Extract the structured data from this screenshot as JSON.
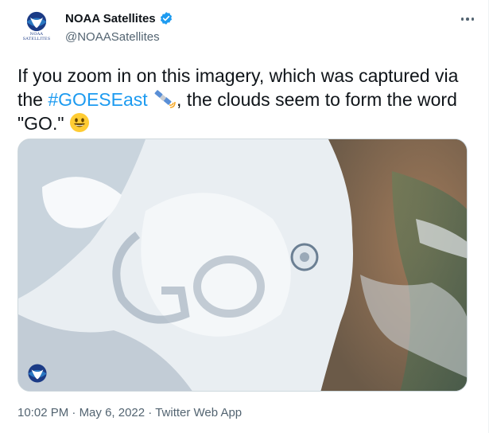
{
  "author": {
    "display_name": "NOAA Satellites",
    "handle": "@NOAASatellites",
    "avatar_icon": "noaa-logo-icon",
    "avatar_text_line1": "NOAA",
    "avatar_text_line2": "SATELLITES",
    "verified": true,
    "verified_color": "#1d9bf0"
  },
  "tweet": {
    "text_part1": "If you zoom in on this imagery, which was captured via the ",
    "hashtag": "#GOESEast",
    "text_part2": ", the clouds seem to form the word \"GO.\"",
    "inline_icons": [
      "satellite-emoji-icon",
      "smiley-emoji-icon"
    ],
    "hashtag_color": "#1d9bf0",
    "media_icon": "noaa-logo-icon"
  },
  "meta": {
    "time": "10:02 PM",
    "date": "May 6, 2022",
    "source": "Twitter Web App",
    "separator": "·"
  },
  "actions": {
    "more_icon": "more-options-icon"
  }
}
